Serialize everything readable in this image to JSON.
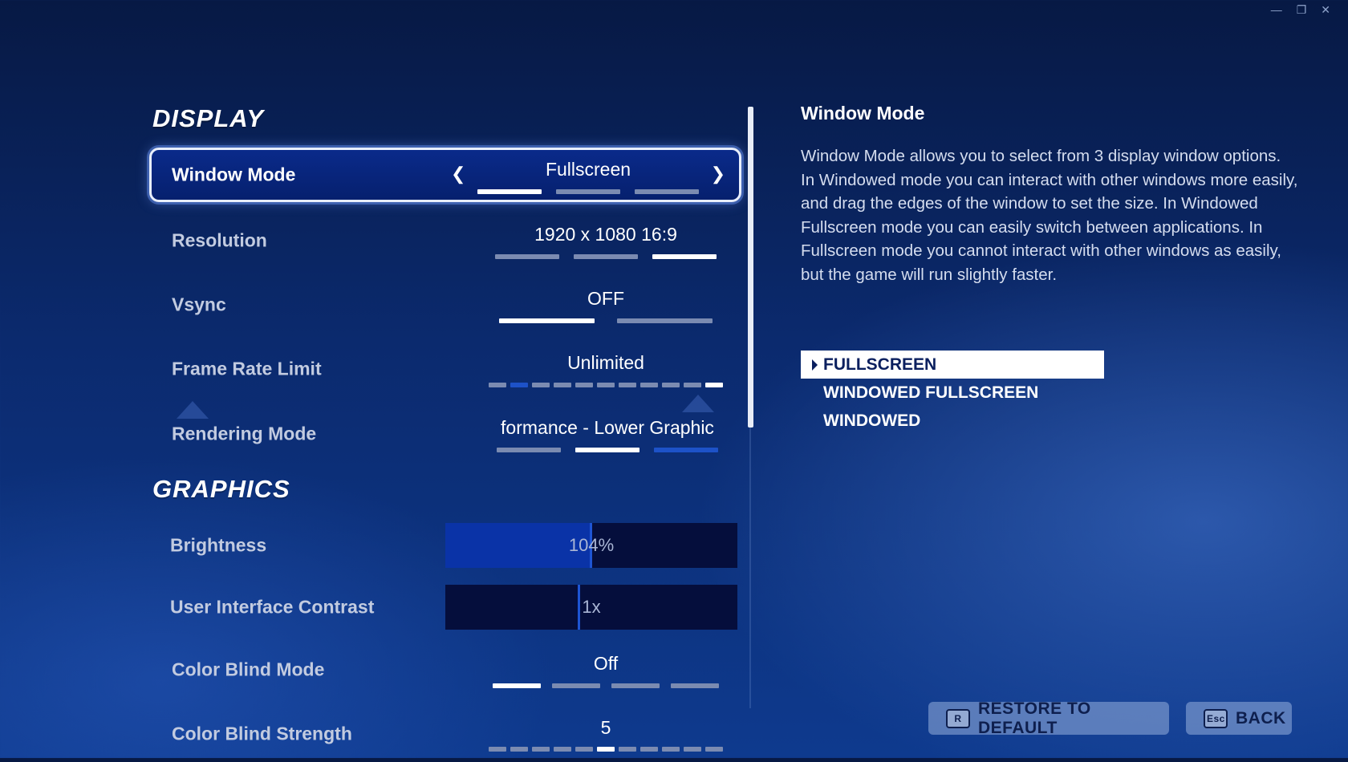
{
  "window_controls": {
    "minimize": "—",
    "restore": "❐",
    "close": "✕"
  },
  "display": {
    "title": "DISPLAY",
    "window_mode": {
      "label": "Window Mode",
      "value": "Fullscreen"
    },
    "resolution": {
      "label": "Resolution",
      "value": "1920 x 1080 16:9"
    },
    "vsync": {
      "label": "Vsync",
      "value": "OFF"
    },
    "frame_rate_limit": {
      "label": "Frame Rate Limit",
      "value": "Unlimited"
    },
    "rendering_mode": {
      "label": "Rendering Mode",
      "value": "formance - Lower Graphic"
    }
  },
  "graphics": {
    "title": "GRAPHICS",
    "brightness": {
      "label": "Brightness",
      "value": "104%",
      "level": 0.5
    },
    "ui_contrast": {
      "label": "User Interface Contrast",
      "value": "1x",
      "level": 0.46
    },
    "color_blind_mode": {
      "label": "Color Blind Mode",
      "value": "Off"
    },
    "color_blind_strength": {
      "label": "Color Blind Strength",
      "value": "5"
    }
  },
  "description": {
    "title": "Window Mode",
    "body": "Window Mode allows you to select from 3 display window options. In Windowed mode you can interact with other windows more easily, and drag the edges of the window to set the size. In Windowed Fullscreen mode you can easily switch between applications. In Fullscreen mode you cannot interact with other windows as easily, but the game will run slightly faster.",
    "options": [
      "FULLSCREEN",
      "WINDOWED FULLSCREEN",
      "WINDOWED"
    ],
    "selected_option": "FULLSCREEN"
  },
  "footer": {
    "restore_key": "R",
    "restore_label": "RESTORE TO DEFAULT",
    "back_key": "Esc",
    "back_label": "BACK"
  },
  "colors": {
    "accent": "#0a33a7",
    "background": "#0b2a6e",
    "highlight": "#ffffff"
  }
}
